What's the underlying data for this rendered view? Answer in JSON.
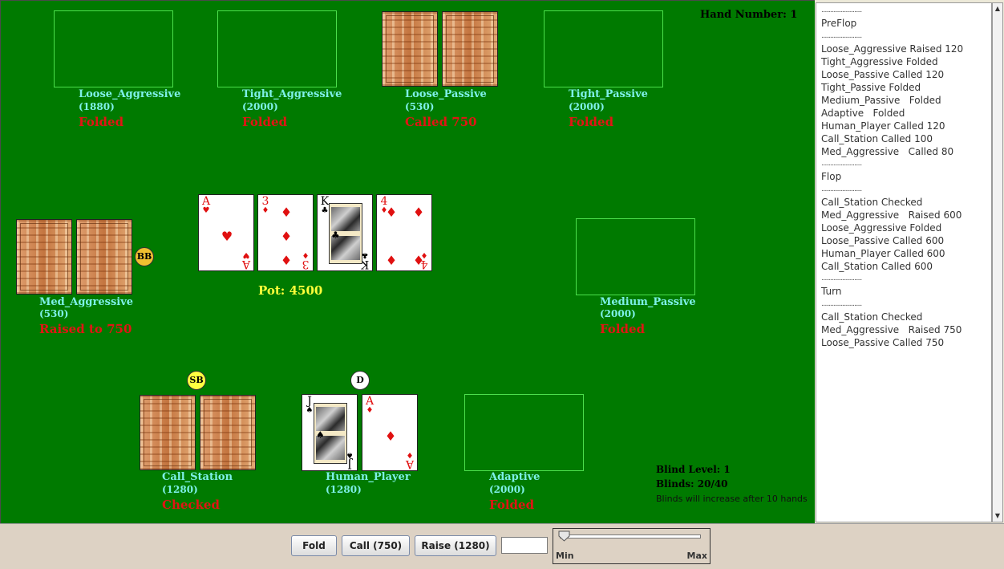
{
  "hand_number": "Hand Number: 1",
  "pot": "Pot: 4500",
  "players": {
    "loose_aggressive": {
      "name": "Loose_Aggressive",
      "chips": "(1880)",
      "action": "Folded"
    },
    "tight_aggressive": {
      "name": "Tight_Aggressive",
      "chips": "(2000)",
      "action": "Folded"
    },
    "loose_passive": {
      "name": "Loose_Passive",
      "chips": "(530)",
      "action": "Called 750"
    },
    "tight_passive": {
      "name": "Tight_Passive",
      "chips": "(2000)",
      "action": "Folded"
    },
    "med_aggressive": {
      "name": "Med_Aggressive",
      "chips": "(530)",
      "action": "Raised to 750"
    },
    "medium_passive": {
      "name": "Medium_Passive",
      "chips": "(2000)",
      "action": "Folded"
    },
    "call_station": {
      "name": "Call_Station",
      "chips": "(1280)",
      "action": "Checked"
    },
    "human_player": {
      "name": "Human_Player",
      "chips": "(1280)",
      "action": ""
    },
    "adaptive": {
      "name": "Adaptive",
      "chips": "(2000)",
      "action": "Folded"
    }
  },
  "markers": {
    "big_blind": "BB",
    "small_blind": "SB",
    "dealer": "D"
  },
  "community_cards": [
    {
      "rank": "A",
      "suit": "♥",
      "color": "red"
    },
    {
      "rank": "3",
      "suit": "♦",
      "color": "red"
    },
    {
      "rank": "K",
      "suit": "♣",
      "color": "black"
    },
    {
      "rank": "4",
      "suit": "♦",
      "color": "red"
    }
  ],
  "human_cards": [
    {
      "rank": "J",
      "suit": "♠",
      "color": "black"
    },
    {
      "rank": "A",
      "suit": "♦",
      "color": "red"
    }
  ],
  "blinds": {
    "level": "Blind Level: 1",
    "amounts": "Blinds: 20/40",
    "note": "Blinds will increase after 10 hands"
  },
  "log": {
    "separator": "...........................",
    "preflop_header": "PreFlop",
    "preflop": [
      "Loose_Aggressive Raised 120",
      "Tight_Aggressive Folded",
      "Loose_Passive Called 120",
      "Tight_Passive Folded",
      "Medium_Passive   Folded",
      "Adaptive   Folded",
      "Human_Player Called 120",
      "Call_Station Called 100",
      "Med_Aggressive   Called 80"
    ],
    "flop_header": "Flop",
    "flop": [
      "Call_Station Checked",
      "Med_Aggressive   Raised 600",
      "Loose_Aggressive Folded",
      "Loose_Passive Called 600",
      "Human_Player Called 600",
      "Call_Station Called 600"
    ],
    "turn_header": "Turn",
    "turn": [
      "Call_Station Checked",
      "Med_Aggressive   Raised 750",
      "Loose_Passive Called 750"
    ]
  },
  "controls": {
    "fold_label": "Fold",
    "call_label": "Call (750)",
    "raise_label": "Raise (1280)",
    "raise_amount": "",
    "slider_min": "Min",
    "slider_max": "Max",
    "slider_value": 0
  },
  "colors": {
    "table": "#007a00",
    "name": "#7ef0e8",
    "action": "#e21414",
    "pot": "#ffff3a",
    "bb_chip": "#f0c030",
    "sb_chip": "#ffff40",
    "dealer_chip": "#ffffff"
  }
}
